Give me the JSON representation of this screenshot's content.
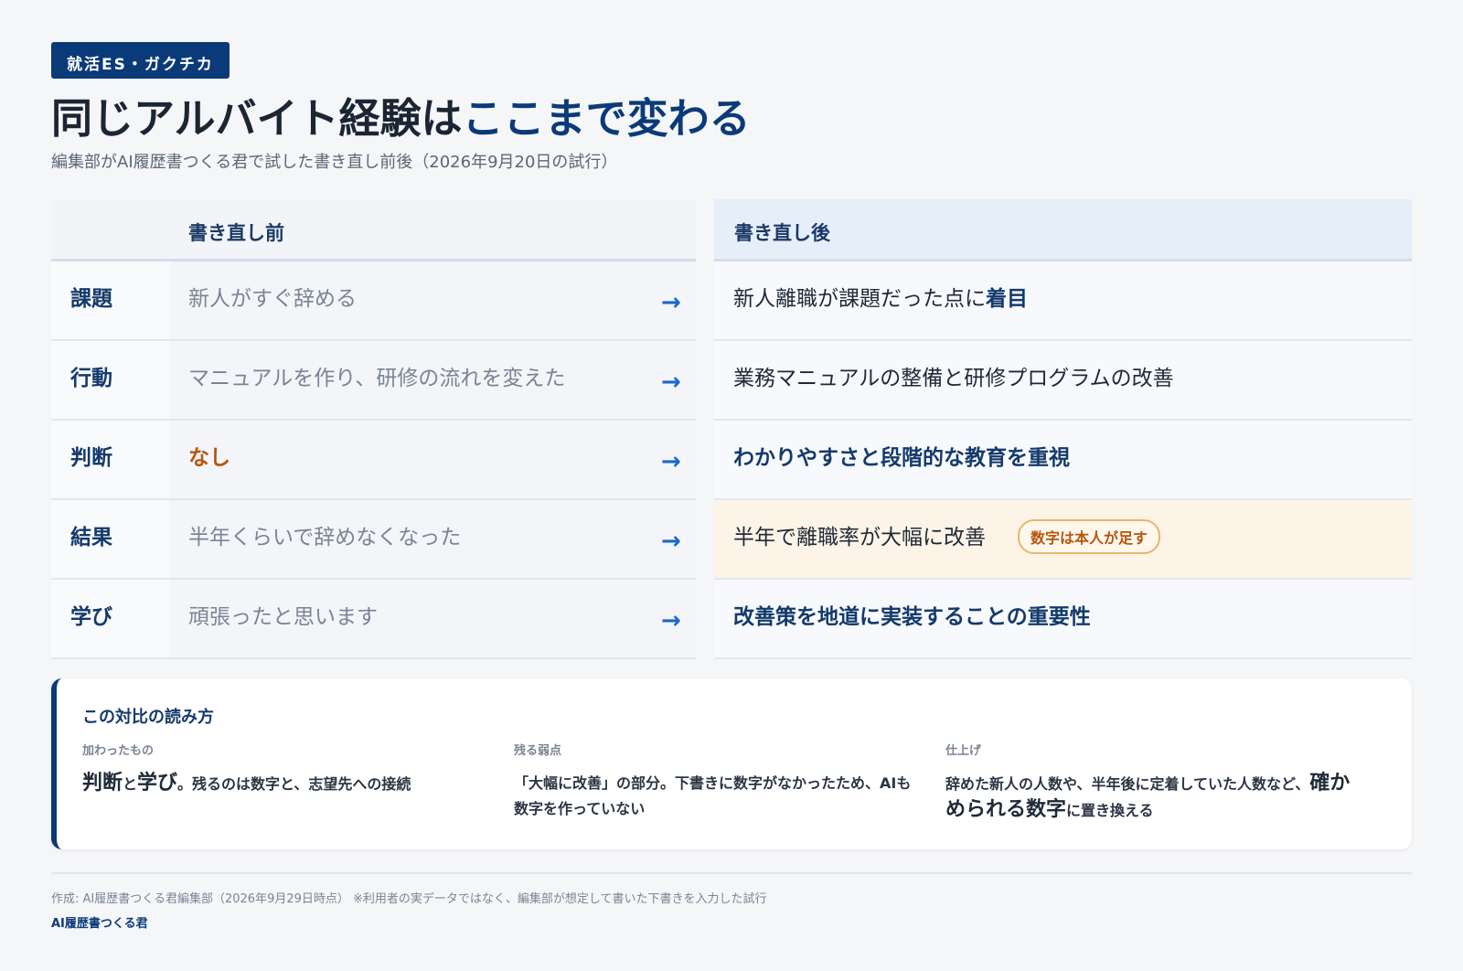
{
  "header": {
    "tag": "就活ES・ガクチカ",
    "title_main": "同じアルバイト経験は",
    "title_accent": "ここまで変わる",
    "subtitle": "編集部がAI履歴書つくる君で試した書き直し前後（2026年9月20日の試行）"
  },
  "table": {
    "col_before": "書き直し前",
    "col_after": "書き直し後",
    "arrow": "→",
    "rows": [
      {
        "label": "課題",
        "before": "新人がすぐ辞める",
        "after": "新人離職が課題だった点に",
        "after_bold": "着目"
      },
      {
        "label": "行動",
        "before": "マニュアルを作り、研修の流れを変えた",
        "after": "業務マニュアルの整備と研修プログラムの改善"
      },
      {
        "label": "判断",
        "before": "なし",
        "after": "わかりやすさと段階的な教育を重視"
      },
      {
        "label": "結果",
        "before": "半年くらいで辞めなくなった",
        "after": "半年で離職率が大幅に改善",
        "badge": "数字は本人が足す"
      },
      {
        "label": "学び",
        "before": "頑張ったと思います",
        "after": "改善策を地道に実装することの重要性"
      }
    ]
  },
  "card": {
    "title": "この対比の読み方",
    "columns": [
      {
        "key": "加わったもの",
        "big1": "判断",
        "mid": "と",
        "big2": "学び",
        "rest": "。残るのは数字と、志望先への接続"
      },
      {
        "key": "残る弱点",
        "text": "「大幅に改善」の部分。下書きに数字がなかったため、AIも数字を作っていない"
      },
      {
        "key": "仕上げ",
        "pre": "辞めた新人の人数や、半年後に定着していた人数など、",
        "big": "確かめられる数字",
        "post": "に置き換える"
      }
    ]
  },
  "footer": {
    "credit": "作成: AI履歴書つくる君編集部（2026年9月29日時点） ※利用者の実データではなく、編集部が想定して書いた下書きを入力した試行",
    "brand": "AI履歴書つくる君"
  },
  "colors": {
    "navy": "#0b3a78",
    "arrow": "#1c68c7",
    "warning": "#b5560d"
  }
}
